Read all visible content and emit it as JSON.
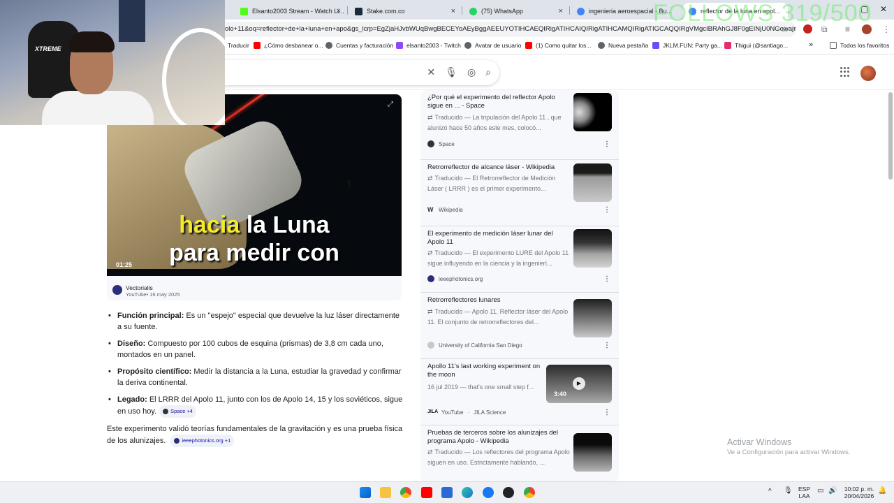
{
  "browser": {
    "tabs": [
      {
        "title": "Elsanto2003 Stream - Watch Li...",
        "favicon_color": "#53fc18"
      },
      {
        "title": "Stake.com.co",
        "favicon_color": "#1a2c38"
      },
      {
        "title": "(75) WhatsApp",
        "favicon_color": "#25d366"
      },
      {
        "title": "ingenieria aeroespacial - Bu...",
        "favicon_color": "#4285f4"
      },
      {
        "title": "reflector de la luna en apol...",
        "favicon_color": "#4285f4"
      }
    ],
    "address_bar": "olo+11&oq=reflector+de+la+luna+en+apo&gs_lcrp=EgZjaHJvbWUqBwgBECEYoAEyBggAEEUYOTIHCAEQIRigATIHCAIQIRigATIHCAMQIRigATIGCAQQIRgVMgcIBRAhGJ8F0gEINjU0NGowajm..."
  },
  "bookmarks": [
    {
      "label": "Traducir",
      "color": "#5f6368"
    },
    {
      "label": "¿Cómo desbanear o...",
      "color": "#ff0000"
    },
    {
      "label": "Cuentas y facturación",
      "color": "#5f6368"
    },
    {
      "label": "elsanto2003 - Twitch",
      "color": "#9146ff"
    },
    {
      "label": "Avatar de usuario",
      "color": "#5f6368"
    },
    {
      "label": "(1) Como quitar los...",
      "color": "#ff0000"
    },
    {
      "label": "Nueva pestaña",
      "color": "#5f6368"
    },
    {
      "label": "JKLM.FUN: Party ga...",
      "color": "#6a4bff"
    },
    {
      "label": "Thigui (@santiago...",
      "color": "#e1306c"
    },
    {
      "label": "»",
      "color": "#5f6368"
    },
    {
      "label": "Todos los favoritos",
      "color": "#5f6368"
    }
  ],
  "overlay": {
    "follows": "FOLLOWS 319/500"
  },
  "video": {
    "caption_line1_yellow": "hacia",
    "caption_line1_white": "la Luna",
    "caption_line2": "para medir con",
    "duration": "01:25",
    "channel": "Vectorialis",
    "meta": "YouTube• 16 may 2025"
  },
  "overview": {
    "bullets": [
      {
        "label": "Función principal:",
        "text": " Es un \"espejo\" especial que devuelve la luz láser directamente a su fuente.",
        "chip": ""
      },
      {
        "label": "Diseño:",
        "text": " Compuesto por 100 cubos de esquina (prismas) de 3,8 cm cada uno, montados en un panel.",
        "chip": ""
      },
      {
        "label": "Propósito científico:",
        "text": " Medir la distancia a la Luna, estudiar la gravedad y confirmar la deriva continental.",
        "chip": ""
      },
      {
        "label": "Legado:",
        "text": " El LRRR del Apolo 11, junto con los de Apolo 14, 15 y los soviéticos, sigue en uso hoy.",
        "chip": "Space +4"
      }
    ],
    "summary": "Este experimento validó teorías fundamentales de la gravitación y es una prueba física de los alunizajes.",
    "summary_chip": "ieeephotonics.org +1"
  },
  "results": [
    {
      "title": "¿Por qué el experimento del reflector Apolo sigue en ... - Space",
      "snippet": "Traducido — La tripulación del Apolo 11 , que alunizó hace 50 años este mes, colocó...",
      "source": "Space",
      "source_sub": ""
    },
    {
      "title": "Retrorreflector de alcance láser - Wikipedia",
      "snippet": "Traducido — El Retrorreflector de Medición Láser ( LRRR ) es el primer experimento...",
      "source": "Wikipedia",
      "source_sub": ""
    },
    {
      "title": "El experimento de medición láser lunar del Apolo 11",
      "snippet": "Traducido — El experimento LURE del Apolo 11 sigue influyendo en la ciencia y la ingenierí...",
      "source": "ieeephotonics.org",
      "source_sub": ""
    },
    {
      "title": "Retrorreflectores lunares",
      "snippet": "Traducido — Apolo 11. Reflector láser del Apolo 11. El conjunto de retrorreflectores del...",
      "source": "University of California San Diego",
      "source_sub": ""
    },
    {
      "title": "Apollo 11's last working experiment on the moon",
      "snippet": "16 jul 2019 — that's one small step f...",
      "source": "YouTube",
      "source_sub": "JILA Science",
      "duration": "3:40"
    },
    {
      "title": "Pruebas de terceros sobre los alunizajes del programa Apolo - Wikipedia",
      "snippet": "Traducido — Los reflectores del programa Apolo siguen en uso. Estrictamente hablando, ...",
      "source": "",
      "source_sub": ""
    }
  ],
  "watermark": {
    "line1": "Activar Windows",
    "line2": "Ve a Configuración para activar Windows."
  },
  "taskbar": {
    "lang": "ESP",
    "lang2": "LAA",
    "time": "10:02 p. m.",
    "date": "20/04/2026",
    "apps": [
      "windows-start",
      "file-explorer",
      "chrome",
      "youtube",
      "store",
      "edge",
      "facebook",
      "app-red",
      "chrome-2"
    ]
  }
}
